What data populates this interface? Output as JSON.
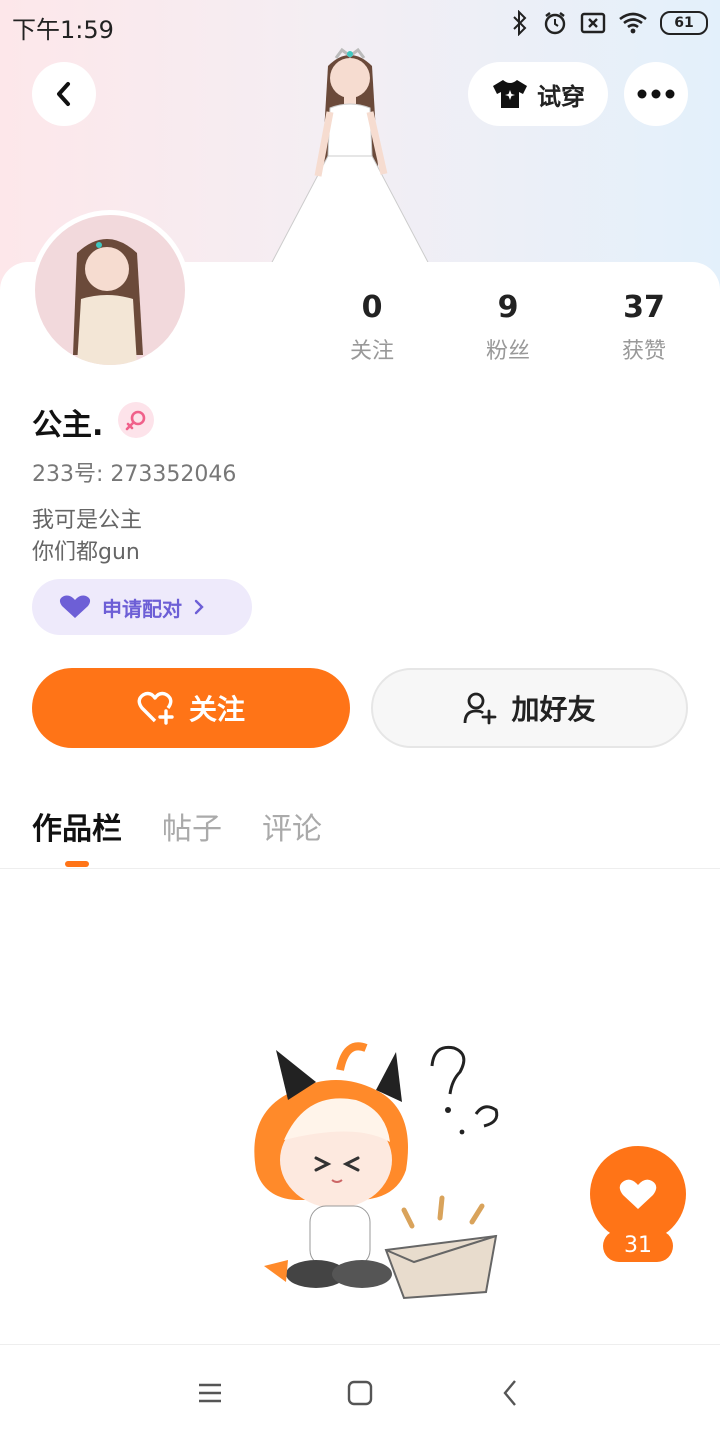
{
  "status_bar": {
    "time": "下午1:59",
    "battery": "61"
  },
  "header": {
    "tryon_label": "试穿"
  },
  "profile": {
    "name": "公主.",
    "uid": "233号: 273352046",
    "bio_line1": "我可是公主",
    "bio_line2": "你们都gun",
    "pair_label": "申请配对"
  },
  "stats": [
    {
      "value": "0",
      "label": "关注"
    },
    {
      "value": "9",
      "label": "粉丝"
    },
    {
      "value": "37",
      "label": "获赞"
    }
  ],
  "actions": {
    "follow_label": "关注",
    "add_friend_label": "加好友"
  },
  "tabs": [
    {
      "label": "作品栏",
      "active": true
    },
    {
      "label": "帖子",
      "active": false
    },
    {
      "label": "评论",
      "active": false
    }
  ],
  "like_count": "31",
  "colors": {
    "accent": "#ff7417",
    "pair_purple": "#6d5fd6"
  }
}
